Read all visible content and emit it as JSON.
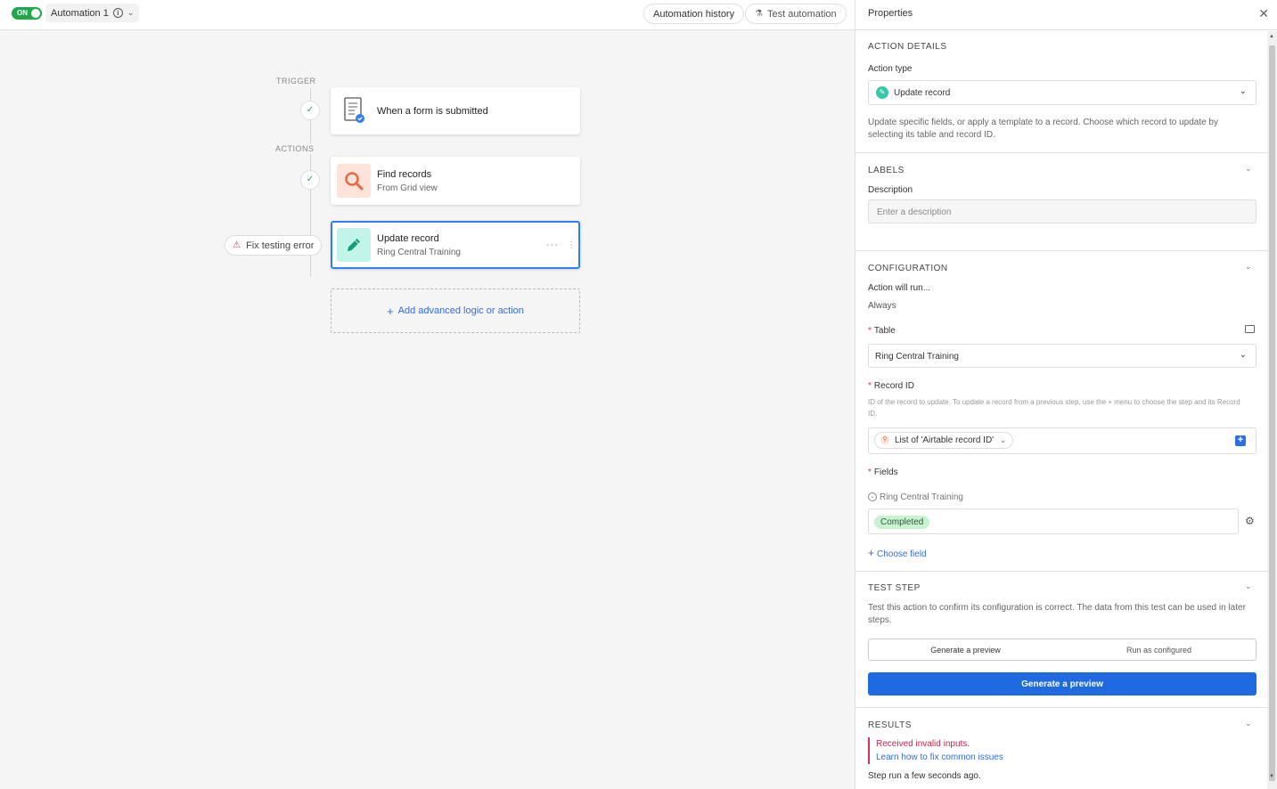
{
  "topbar": {
    "toggle_label": "ON",
    "automation_name": "Automation 1",
    "history_label": "Automation history",
    "test_label": "Test automation"
  },
  "canvas": {
    "trigger_label": "TRIGGER",
    "actions_label": "ACTIONS",
    "trigger_card": {
      "title": "When a form is submitted"
    },
    "find_card": {
      "title": "Find records",
      "subtitle": "From Grid view"
    },
    "update_card": {
      "title": "Update record",
      "subtitle": "Ring Central Training",
      "more": "···",
      "handle": "⋮⋮"
    },
    "fix_error_label": "Fix testing error",
    "add_logic_label": "Add advanced logic or action"
  },
  "panel": {
    "title": "Properties",
    "action_details": {
      "heading": "ACTION DETAILS",
      "action_type_label": "Action type",
      "action_type_value": "Update record",
      "help": "Update specific fields, or apply a template to a record. Choose which record to update by selecting its table and record ID."
    },
    "labels": {
      "heading": "LABELS",
      "description_label": "Description",
      "description_placeholder": "Enter a description"
    },
    "configuration": {
      "heading": "CONFIGURATION",
      "action_will_run_label": "Action will run...",
      "action_will_run_value": "Always",
      "table_label": "Table",
      "table_value": "Ring Central Training",
      "record_id_label": "Record ID",
      "record_id_help": "ID of the record to update. To update a record from a previous step, use the + menu to choose the step and its Record ID.",
      "record_id_token": "List of 'Airtable record ID'",
      "fields_label": "Fields",
      "field_name": "Ring Central Training",
      "field_value": "Completed",
      "choose_field_label": "Choose field"
    },
    "test_step": {
      "heading": "TEST STEP",
      "help": "Test this action to confirm its configuration is correct. The data from this test can be used in later steps.",
      "seg_preview": "Generate a preview",
      "seg_run": "Run as configured",
      "primary_label": "Generate a preview"
    },
    "results": {
      "heading": "RESULTS",
      "error": "Received invalid inputs.",
      "learn_link": "Learn how to fix common issues",
      "step_run": "Step run a few seconds ago."
    }
  },
  "colors": {
    "accent_blue": "#2d7ff9",
    "primary_button": "#1f6ae0",
    "toggle_green": "#20a84b",
    "error_red": "#d6315b",
    "completed_green": "#c9f2d1"
  },
  "icons": [
    "info-icon",
    "chevron-down-icon",
    "flask-icon",
    "form-icon",
    "search-icon",
    "pencil-icon",
    "check-icon",
    "warning-icon",
    "plus-icon",
    "close-icon",
    "table-icon",
    "gear-icon"
  ]
}
